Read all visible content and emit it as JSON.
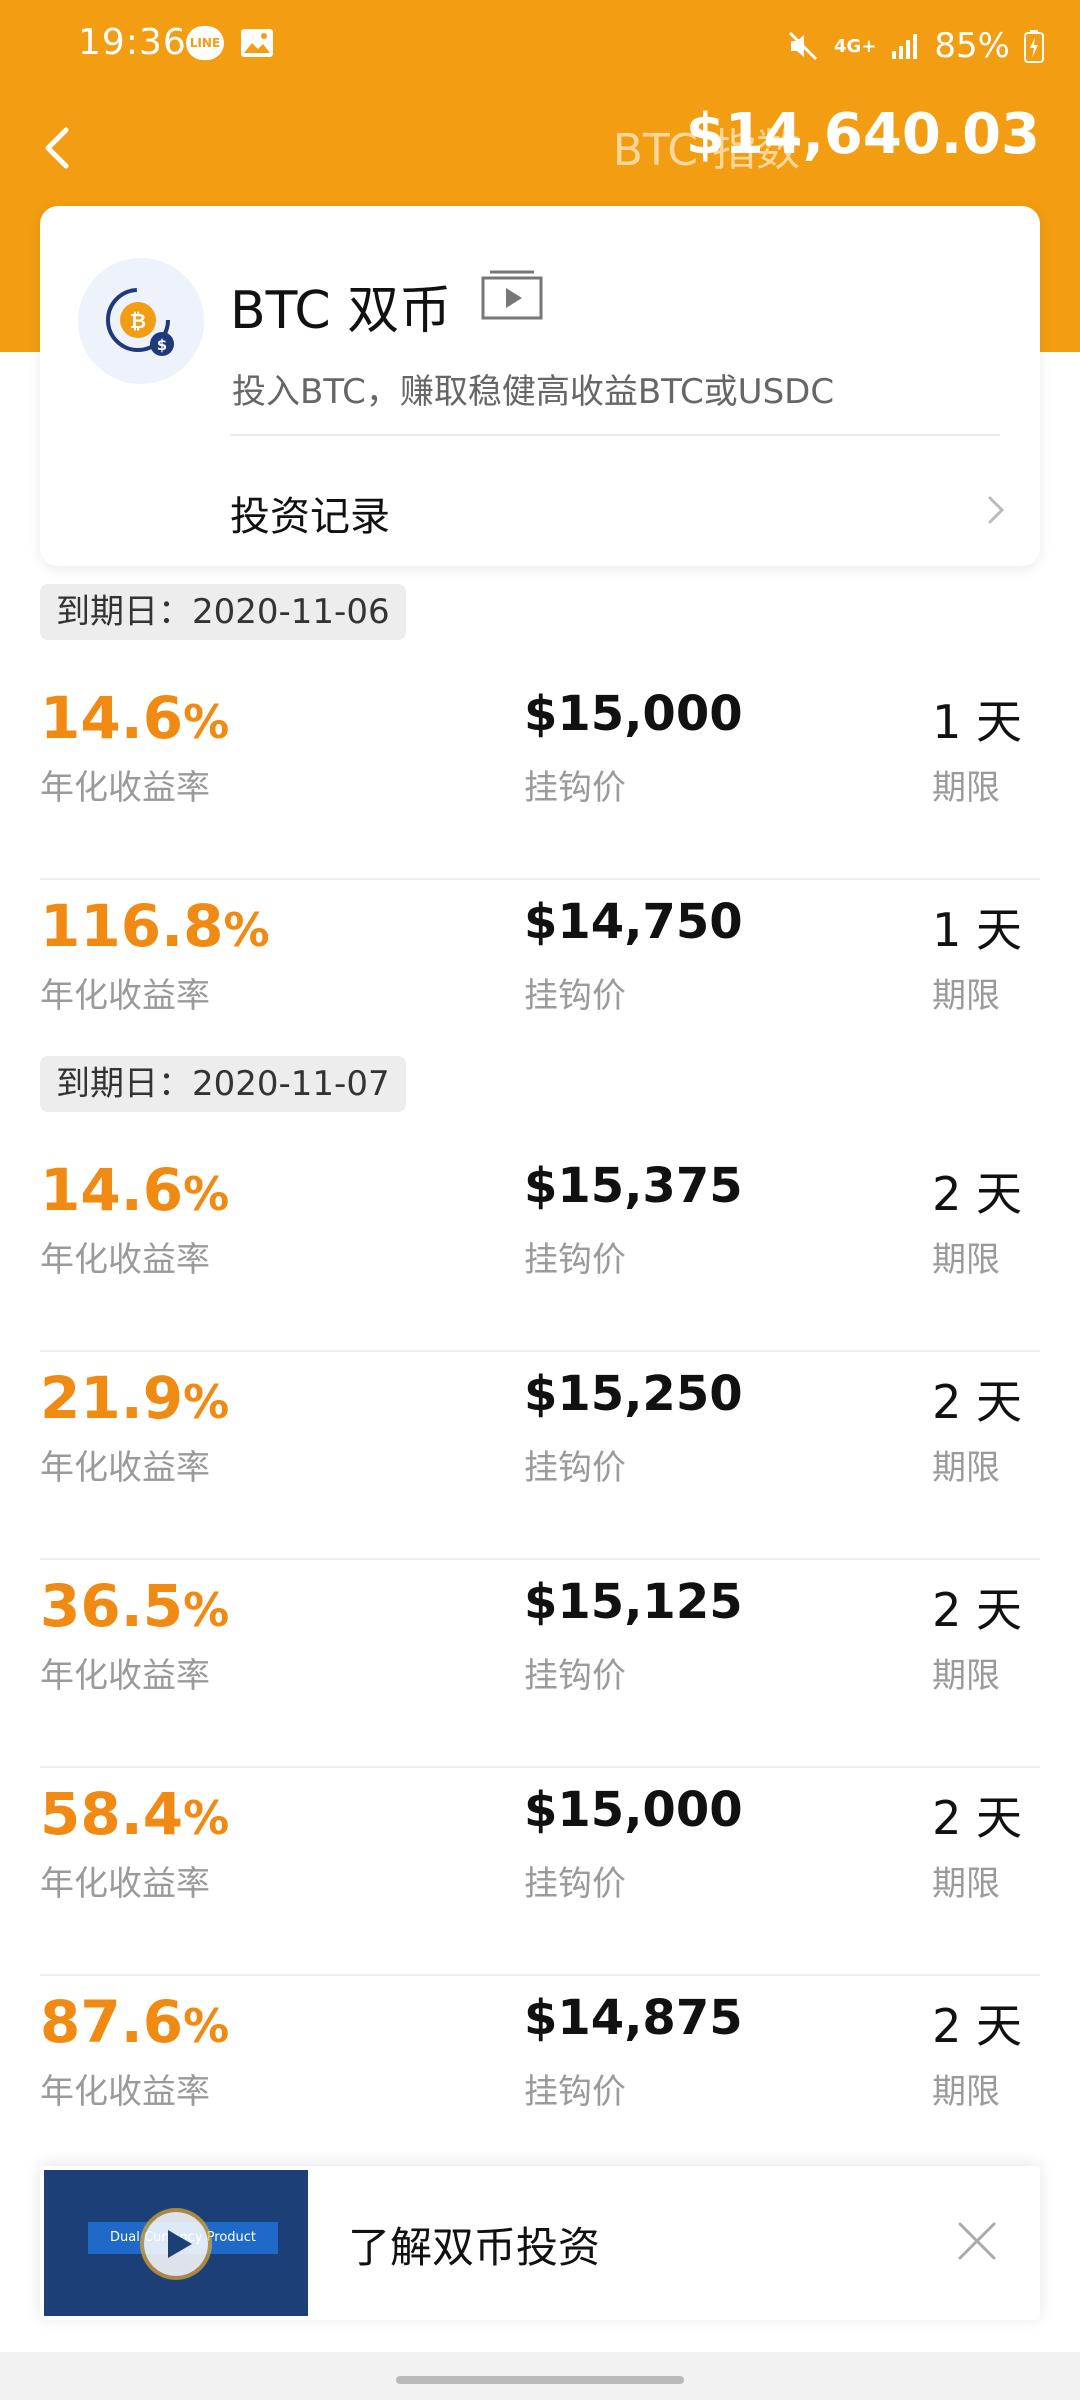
{
  "status_bar": {
    "time": "19:36",
    "line_icon": "LINE",
    "network": "4G+",
    "battery": "85%"
  },
  "header": {
    "index_label": "BTC 指数",
    "index_value": "$14,640.03"
  },
  "product": {
    "title": "BTC 双币",
    "subtitle": "投入BTC，赚取稳健高收益BTC或USDC",
    "records_label": "投资记录"
  },
  "labels": {
    "rate": "年化收益率",
    "price": "挂钩价",
    "term": "期限",
    "date_prefix": "到期日："
  },
  "groups": [
    {
      "date": "2020-11-06",
      "rows": [
        {
          "rate": "14.6",
          "pct": "%",
          "price": "$15,000",
          "term": "1 天"
        },
        {
          "rate": "116.8",
          "pct": "%",
          "price": "$14,750",
          "term": "1 天"
        }
      ]
    },
    {
      "date": "2020-11-07",
      "rows": [
        {
          "rate": "14.6",
          "pct": "%",
          "price": "$15,375",
          "term": "2 天"
        },
        {
          "rate": "21.9",
          "pct": "%",
          "price": "$15,250",
          "term": "2 天"
        },
        {
          "rate": "36.5",
          "pct": "%",
          "price": "$15,125",
          "term": "2 天"
        },
        {
          "rate": "58.4",
          "pct": "%",
          "price": "$15,000",
          "term": "2 天"
        },
        {
          "rate": "87.6",
          "pct": "%",
          "price": "$14,875",
          "term": "2 天"
        }
      ]
    }
  ],
  "promo": {
    "text": "了解双币投资",
    "thumb_text": "Dual Currency Product"
  },
  "colors": {
    "brand": "#F29D12",
    "rate": "#F08A12"
  }
}
